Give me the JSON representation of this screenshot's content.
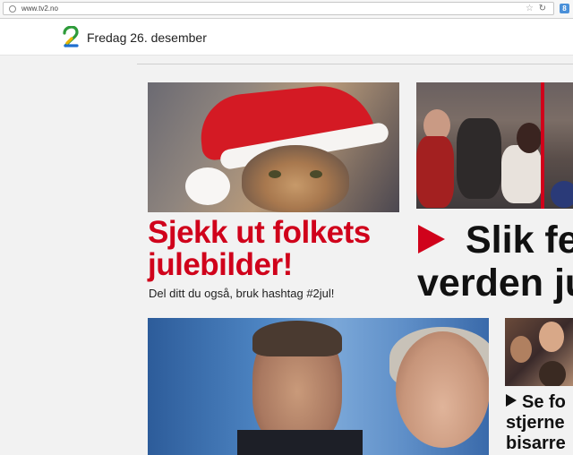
{
  "browser": {
    "url": "www.tv2.no",
    "extension_icon_letter": "8"
  },
  "header": {
    "logo_name": "tv2-logo",
    "date": "Fredag 26. desember"
  },
  "articles": [
    {
      "headline": "Sjekk ut folkets julebilder!",
      "subtitle": "Del ditt du også, bruk hashtag #2jul!",
      "image": "cat-with-santa-hat"
    },
    {
      "headline_line1": "Slik fe",
      "headline_line2": "verden ju",
      "image": "crowd-at-tables",
      "has_play_icon": true
    },
    {
      "image": "tv-presenters"
    },
    {
      "headline_line1": "Se fo",
      "headline_line2": "stjerne",
      "headline_line3": "bisarre",
      "image": "selfie-group",
      "has_play_icon": true
    }
  ],
  "colors": {
    "accent": "#d0021b",
    "text": "#111111",
    "background": "#f2f2f2"
  }
}
